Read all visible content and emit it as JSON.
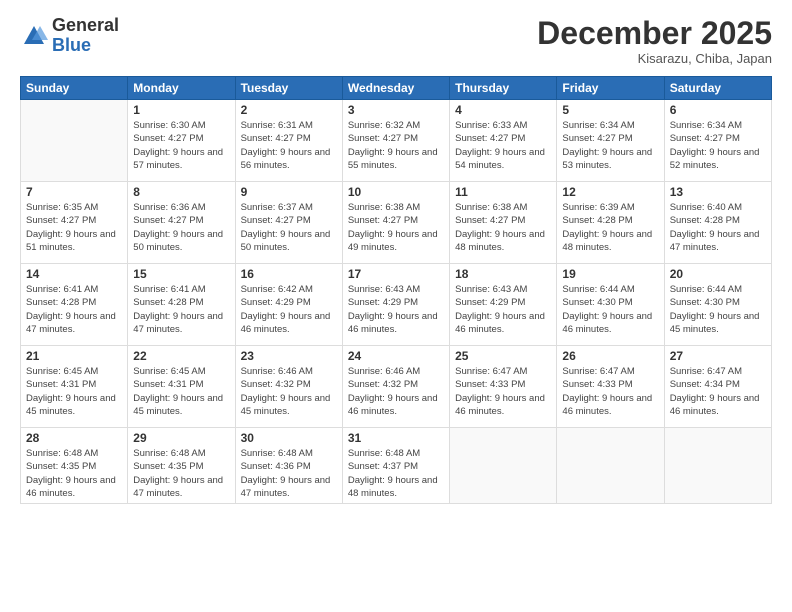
{
  "logo": {
    "general": "General",
    "blue": "Blue"
  },
  "header": {
    "month": "December 2025",
    "location": "Kisarazu, Chiba, Japan"
  },
  "weekdays": [
    "Sunday",
    "Monday",
    "Tuesday",
    "Wednesday",
    "Thursday",
    "Friday",
    "Saturday"
  ],
  "weeks": [
    [
      {
        "day": "",
        "info": ""
      },
      {
        "day": "1",
        "info": "Sunrise: 6:30 AM\nSunset: 4:27 PM\nDaylight: 9 hours\nand 57 minutes."
      },
      {
        "day": "2",
        "info": "Sunrise: 6:31 AM\nSunset: 4:27 PM\nDaylight: 9 hours\nand 56 minutes."
      },
      {
        "day": "3",
        "info": "Sunrise: 6:32 AM\nSunset: 4:27 PM\nDaylight: 9 hours\nand 55 minutes."
      },
      {
        "day": "4",
        "info": "Sunrise: 6:33 AM\nSunset: 4:27 PM\nDaylight: 9 hours\nand 54 minutes."
      },
      {
        "day": "5",
        "info": "Sunrise: 6:34 AM\nSunset: 4:27 PM\nDaylight: 9 hours\nand 53 minutes."
      },
      {
        "day": "6",
        "info": "Sunrise: 6:34 AM\nSunset: 4:27 PM\nDaylight: 9 hours\nand 52 minutes."
      }
    ],
    [
      {
        "day": "7",
        "info": "Sunrise: 6:35 AM\nSunset: 4:27 PM\nDaylight: 9 hours\nand 51 minutes."
      },
      {
        "day": "8",
        "info": "Sunrise: 6:36 AM\nSunset: 4:27 PM\nDaylight: 9 hours\nand 50 minutes."
      },
      {
        "day": "9",
        "info": "Sunrise: 6:37 AM\nSunset: 4:27 PM\nDaylight: 9 hours\nand 50 minutes."
      },
      {
        "day": "10",
        "info": "Sunrise: 6:38 AM\nSunset: 4:27 PM\nDaylight: 9 hours\nand 49 minutes."
      },
      {
        "day": "11",
        "info": "Sunrise: 6:38 AM\nSunset: 4:27 PM\nDaylight: 9 hours\nand 48 minutes."
      },
      {
        "day": "12",
        "info": "Sunrise: 6:39 AM\nSunset: 4:28 PM\nDaylight: 9 hours\nand 48 minutes."
      },
      {
        "day": "13",
        "info": "Sunrise: 6:40 AM\nSunset: 4:28 PM\nDaylight: 9 hours\nand 47 minutes."
      }
    ],
    [
      {
        "day": "14",
        "info": "Sunrise: 6:41 AM\nSunset: 4:28 PM\nDaylight: 9 hours\nand 47 minutes."
      },
      {
        "day": "15",
        "info": "Sunrise: 6:41 AM\nSunset: 4:28 PM\nDaylight: 9 hours\nand 47 minutes."
      },
      {
        "day": "16",
        "info": "Sunrise: 6:42 AM\nSunset: 4:29 PM\nDaylight: 9 hours\nand 46 minutes."
      },
      {
        "day": "17",
        "info": "Sunrise: 6:43 AM\nSunset: 4:29 PM\nDaylight: 9 hours\nand 46 minutes."
      },
      {
        "day": "18",
        "info": "Sunrise: 6:43 AM\nSunset: 4:29 PM\nDaylight: 9 hours\nand 46 minutes."
      },
      {
        "day": "19",
        "info": "Sunrise: 6:44 AM\nSunset: 4:30 PM\nDaylight: 9 hours\nand 46 minutes."
      },
      {
        "day": "20",
        "info": "Sunrise: 6:44 AM\nSunset: 4:30 PM\nDaylight: 9 hours\nand 45 minutes."
      }
    ],
    [
      {
        "day": "21",
        "info": "Sunrise: 6:45 AM\nSunset: 4:31 PM\nDaylight: 9 hours\nand 45 minutes."
      },
      {
        "day": "22",
        "info": "Sunrise: 6:45 AM\nSunset: 4:31 PM\nDaylight: 9 hours\nand 45 minutes."
      },
      {
        "day": "23",
        "info": "Sunrise: 6:46 AM\nSunset: 4:32 PM\nDaylight: 9 hours\nand 45 minutes."
      },
      {
        "day": "24",
        "info": "Sunrise: 6:46 AM\nSunset: 4:32 PM\nDaylight: 9 hours\nand 46 minutes."
      },
      {
        "day": "25",
        "info": "Sunrise: 6:47 AM\nSunset: 4:33 PM\nDaylight: 9 hours\nand 46 minutes."
      },
      {
        "day": "26",
        "info": "Sunrise: 6:47 AM\nSunset: 4:33 PM\nDaylight: 9 hours\nand 46 minutes."
      },
      {
        "day": "27",
        "info": "Sunrise: 6:47 AM\nSunset: 4:34 PM\nDaylight: 9 hours\nand 46 minutes."
      }
    ],
    [
      {
        "day": "28",
        "info": "Sunrise: 6:48 AM\nSunset: 4:35 PM\nDaylight: 9 hours\nand 46 minutes."
      },
      {
        "day": "29",
        "info": "Sunrise: 6:48 AM\nSunset: 4:35 PM\nDaylight: 9 hours\nand 47 minutes."
      },
      {
        "day": "30",
        "info": "Sunrise: 6:48 AM\nSunset: 4:36 PM\nDaylight: 9 hours\nand 47 minutes."
      },
      {
        "day": "31",
        "info": "Sunrise: 6:48 AM\nSunset: 4:37 PM\nDaylight: 9 hours\nand 48 minutes."
      },
      {
        "day": "",
        "info": ""
      },
      {
        "day": "",
        "info": ""
      },
      {
        "day": "",
        "info": ""
      }
    ]
  ]
}
